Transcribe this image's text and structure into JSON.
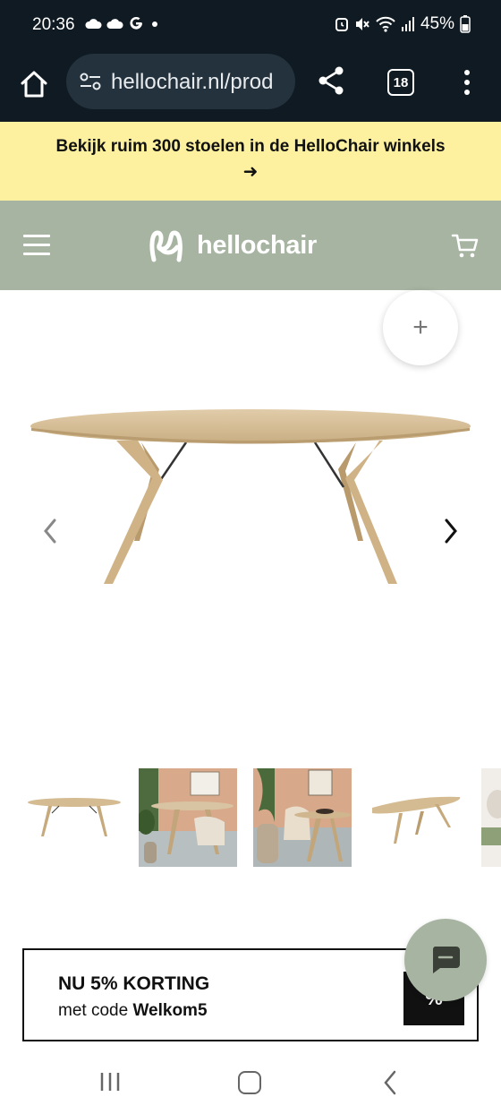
{
  "status_bar": {
    "time": "20:36",
    "battery": "45%",
    "icons": [
      "cloud-icon",
      "cloud-icon",
      "google-icon",
      "dot-icon",
      "alarm-icon",
      "mute-icon",
      "wifi-icon",
      "signal-icon",
      "battery-icon"
    ]
  },
  "browser": {
    "url": "hellochair.nl/prod",
    "tab_count": "18"
  },
  "promo": {
    "text": "Bekijk ruim 300 stoelen in de HelloChair winkels",
    "arrow": "➜"
  },
  "header": {
    "logo_text": "hellochair"
  },
  "gallery": {
    "zoom_label": "+",
    "thumbnail_count": 5
  },
  "discount": {
    "title": "NU 5% KORTING",
    "subtitle_prefix": "met code ",
    "code": "Welkom5",
    "badge": "%"
  },
  "colors": {
    "dark_bar": "#0f1a23",
    "promo_bg": "#fdf09e",
    "header_bg": "#a7b4a2",
    "wood": "#d9c29b"
  }
}
